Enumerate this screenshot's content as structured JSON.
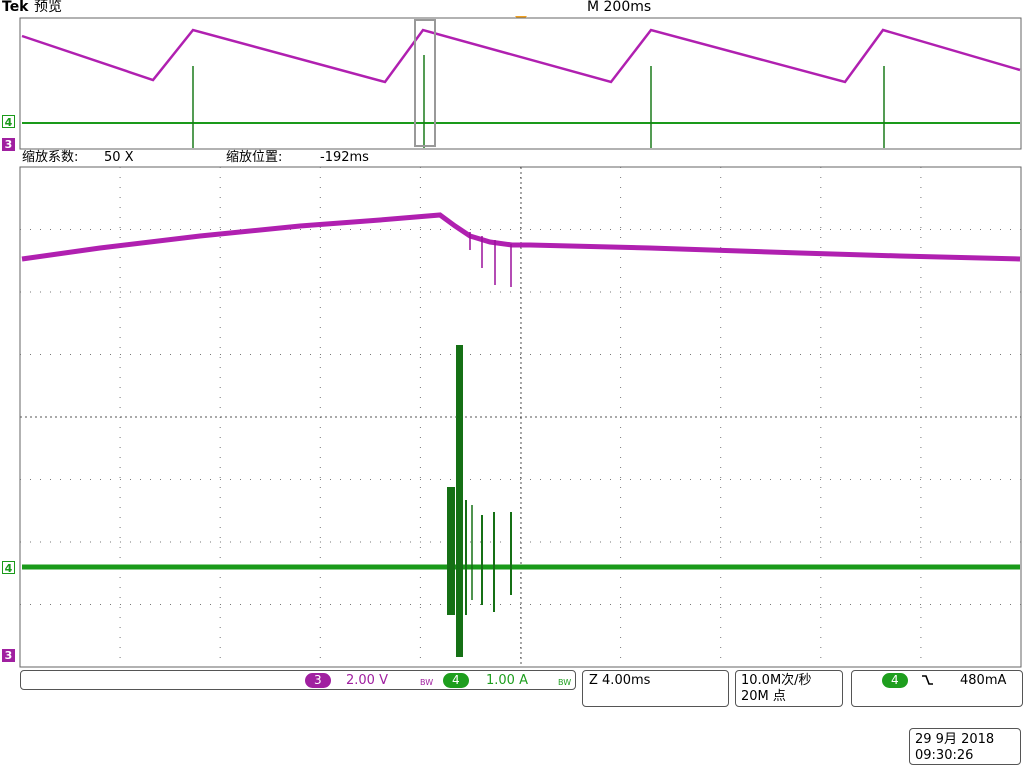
{
  "header": {
    "brand": "Tek",
    "mode": "预览",
    "timebase": "M 200ms"
  },
  "zoom": {
    "factor_label": "缩放系数:",
    "factor_value": "50 X",
    "position_label": "缩放位置:",
    "position_value": "-192ms"
  },
  "channels": {
    "ch3": {
      "id": "3",
      "scale": "2.00 V",
      "bw_mark": "BW",
      "color": "#a020a0"
    },
    "ch4": {
      "id": "4",
      "scale": "1.00 A",
      "bw_mark": "BW",
      "color": "#1e9e1e"
    }
  },
  "zoom_timebase": "Z 4.00ms",
  "acquisition": {
    "rate": "10.0M次/秒",
    "points": "20M 点"
  },
  "trigger": {
    "source": "4",
    "slope_icon": "falling-edge-icon",
    "level": "480mA"
  },
  "datetime": {
    "date": "29 9月  2018",
    "time": "09:30:26"
  },
  "colors": {
    "ch3_trace": "#b020b0",
    "ch4_trace": "#1a9a1a",
    "trigger_marker": "#f0a020",
    "grid": "#555555"
  }
}
